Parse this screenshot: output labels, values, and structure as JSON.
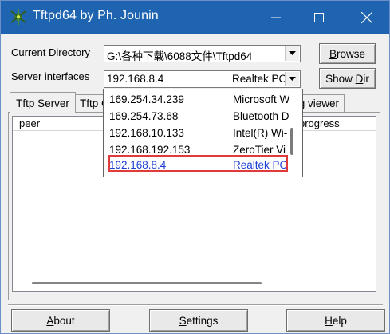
{
  "window": {
    "title": "Tftpd64 by Ph. Jounin",
    "title_bar_color": "#1f64b0",
    "minimize_icon": "minimize-icon",
    "maximize_icon": "maximize-icon",
    "close_icon": "close-icon"
  },
  "current_directory": {
    "label": "Current Directory",
    "value": "G:\\各种下载\\6088文件\\Tftpd64",
    "browse_label": "Browse"
  },
  "server_interfaces": {
    "label": "Server interfaces",
    "selected_ip": "192.168.8.4",
    "selected_nic": "Realtek PC",
    "show_dir_label": "Show Dir"
  },
  "dropdown_options": [
    {
      "ip": "169.254.34.239",
      "nic": "Microsoft W"
    },
    {
      "ip": "169.254.73.68",
      "nic": "Bluetooth D"
    },
    {
      "ip": "192.168.10.133",
      "nic": "Intel(R) Wi-"
    },
    {
      "ip": "192.168.192.153",
      "nic": "ZeroTier Vi"
    },
    {
      "ip": "192.168.8.4",
      "nic": "Realtek PC"
    }
  ],
  "tabs": [
    {
      "label": "Tftp Server"
    },
    {
      "label": "Tftp C"
    },
    {
      "label": "g viewer"
    }
  ],
  "table": {
    "columns": [
      "peer",
      "progress"
    ]
  },
  "bottom_buttons": {
    "about": "About",
    "settings": "Settings",
    "help": "Help"
  },
  "colors": {
    "selected_option_text": "#1b3fd6",
    "highlight_box": "#e03a3a"
  }
}
